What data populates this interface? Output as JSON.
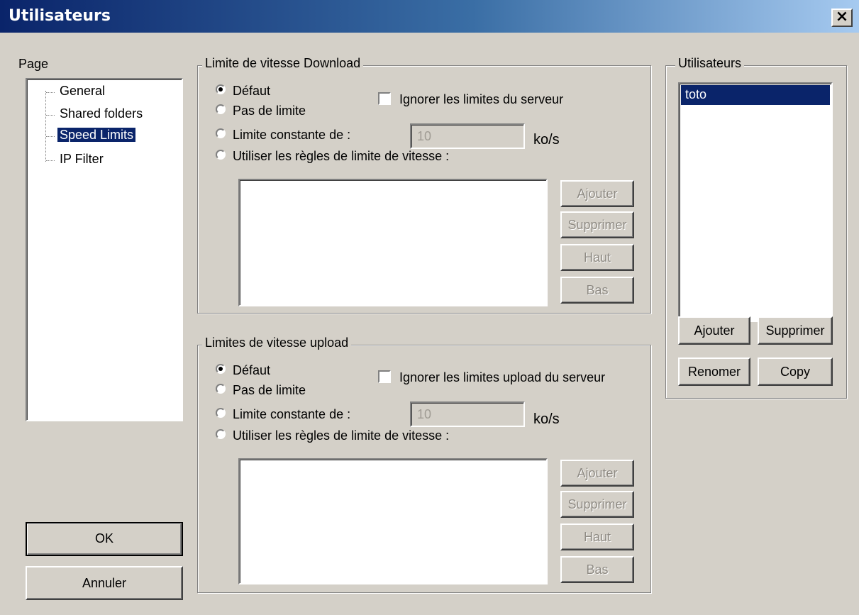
{
  "window": {
    "title": "Utilisateurs",
    "close_symbol": "×"
  },
  "page_panel": {
    "label": "Page",
    "items": [
      {
        "label": "General",
        "selected": false
      },
      {
        "label": "Shared folders",
        "selected": false
      },
      {
        "label": "Speed Limits",
        "selected": true
      },
      {
        "label": "IP Filter",
        "selected": false
      }
    ]
  },
  "download": {
    "legend": "Limite de vitesse Download",
    "options": {
      "default": "Défaut",
      "no_limit": "Pas de limite",
      "constant": "Limite constante de :",
      "rules": "Utiliser les règles de limite de vitesse :"
    },
    "selected": "default",
    "ignore_server_label": "Ignorer les limites du serveur",
    "ignore_server_checked": false,
    "constant_value": "10",
    "unit": "ko/s",
    "buttons": {
      "add": "Ajouter",
      "remove": "Supprimer",
      "up": "Haut",
      "down": "Bas"
    }
  },
  "upload": {
    "legend": "Limites de vitesse upload",
    "options": {
      "default": "Défaut",
      "no_limit": "Pas de limite",
      "constant": "Limite constante de :",
      "rules": "Utiliser les règles de limite de vitesse :"
    },
    "selected": "default",
    "ignore_server_label": "Ignorer les limites upload du serveur",
    "ignore_server_checked": false,
    "constant_value": "10",
    "unit": "ko/s",
    "buttons": {
      "add": "Ajouter",
      "remove": "Supprimer",
      "up": "Haut",
      "down": "Bas"
    }
  },
  "users": {
    "legend": "Utilisateurs",
    "list": [
      "toto"
    ],
    "selected_index": 0,
    "buttons": {
      "add": "Ajouter",
      "remove": "Supprimer",
      "rename": "Renomer",
      "copy": "Copy"
    }
  },
  "dialog_buttons": {
    "ok": "OK",
    "cancel": "Annuler"
  },
  "colors": {
    "dialog_bg": "#d4d0c8",
    "titlebar_start": "#0a246a",
    "titlebar_end": "#a6caf0",
    "selection": "#0a246a"
  }
}
